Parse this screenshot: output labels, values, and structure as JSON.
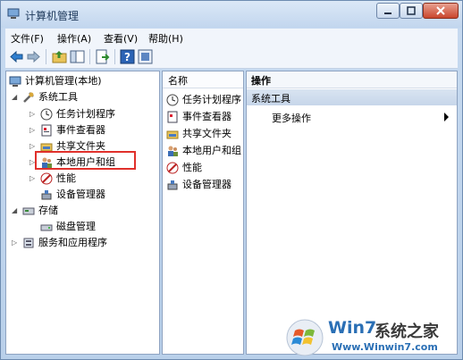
{
  "window": {
    "title": "计算机管理"
  },
  "menu": [
    "文件(F)",
    "操作(A)",
    "查看(V)",
    "帮助(H)"
  ],
  "tree": {
    "root": "计算机管理(本地)",
    "system_tools": "系统工具",
    "system_children": [
      "任务计划程序",
      "事件查看器",
      "共享文件夹",
      "本地用户和组",
      "性能",
      "设备管理器"
    ],
    "storage": "存储",
    "storage_children": [
      "磁盘管理"
    ],
    "services": "服务和应用程序"
  },
  "middle": {
    "header": "名称",
    "items": [
      "任务计划程序",
      "事件查看器",
      "共享文件夹",
      "本地用户和组",
      "性能",
      "设备管理器"
    ]
  },
  "actions": {
    "header": "操作",
    "section": "系统工具",
    "item": "更多操作"
  },
  "watermark": {
    "brand_a": "Win7",
    "brand_b": "系统之家",
    "url": "Www.Winwin7.com"
  }
}
